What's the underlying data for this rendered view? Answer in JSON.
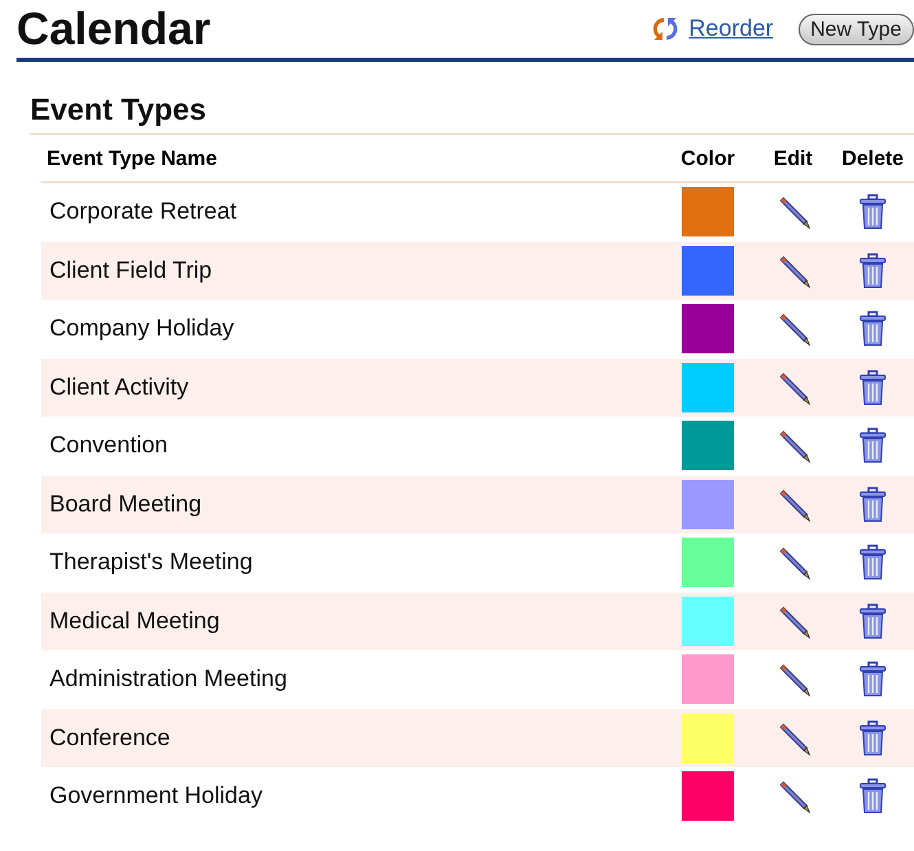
{
  "page": {
    "title": "Calendar",
    "reorder_link": "Reorder",
    "new_button": "New Type"
  },
  "section": {
    "title": "Event Types"
  },
  "table": {
    "columns": [
      "Event Type Name",
      "Color",
      "Edit",
      "Delete"
    ],
    "rows": [
      {
        "name": "Corporate Retreat",
        "color": "#e07010"
      },
      {
        "name": "Client Field Trip",
        "color": "#3366ff"
      },
      {
        "name": "Company Holiday",
        "color": "#990099"
      },
      {
        "name": "Client Activity",
        "color": "#00ccff"
      },
      {
        "name": "Convention",
        "color": "#009999"
      },
      {
        "name": "Board Meeting",
        "color": "#9999ff"
      },
      {
        "name": "Therapist's Meeting",
        "color": "#66ff99"
      },
      {
        "name": "Medical Meeting",
        "color": "#66ffff"
      },
      {
        "name": "Administration Meeting",
        "color": "#ff99cc"
      },
      {
        "name": "Conference",
        "color": "#ffff66"
      },
      {
        "name": "Government Holiday",
        "color": "#ff0066"
      }
    ]
  }
}
